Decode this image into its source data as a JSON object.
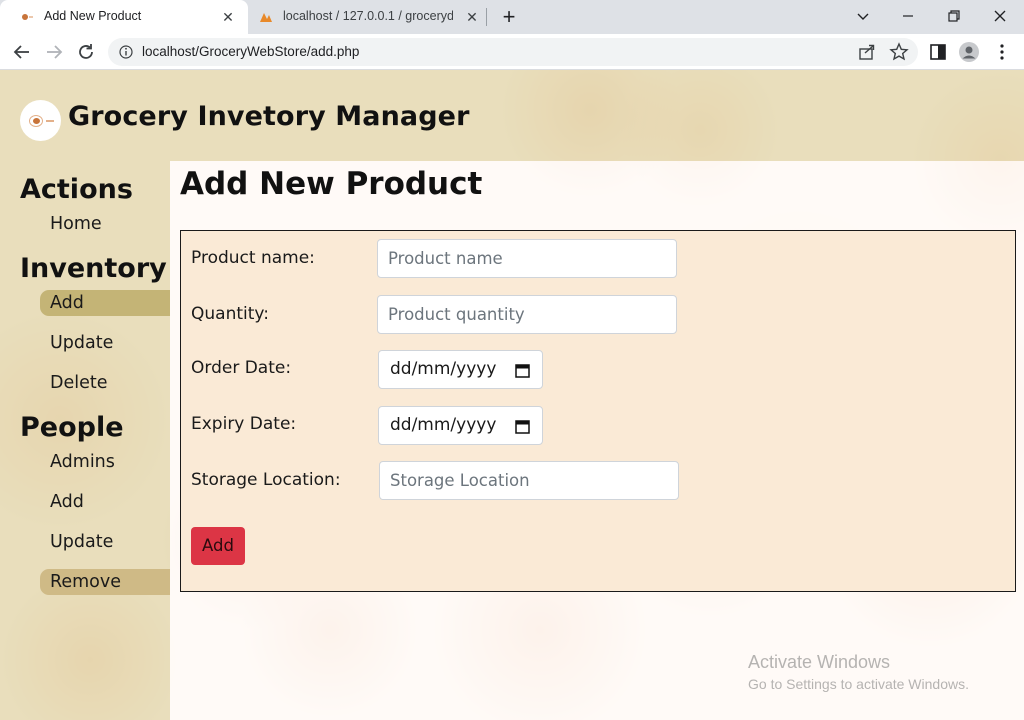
{
  "browser": {
    "tabs": [
      {
        "title": "Add New Product",
        "active": true
      },
      {
        "title": "localhost / 127.0.0.1 / grocerydb",
        "active": false
      }
    ],
    "address": "localhost/GroceryWebStore/add.php"
  },
  "app": {
    "title": "Grocery Invetory Manager"
  },
  "sidebar": {
    "sections": [
      {
        "heading": "Actions",
        "items": [
          {
            "label": "Home"
          }
        ]
      },
      {
        "heading": "Inventory",
        "items": [
          {
            "label": "Add",
            "selected": true
          },
          {
            "label": "Update"
          },
          {
            "label": "Delete"
          }
        ]
      },
      {
        "heading": "People",
        "items": [
          {
            "label": "Admins"
          },
          {
            "label": "Add"
          },
          {
            "label": "Update"
          },
          {
            "label": "Remove",
            "hovered": true
          }
        ]
      }
    ]
  },
  "main": {
    "title": "Add New Product",
    "form": {
      "fields": [
        {
          "label": "Product name:",
          "placeholder": "Product name"
        },
        {
          "label": "Quantity:",
          "placeholder": "Product quantity"
        },
        {
          "label": "Order Date:",
          "value": "dd/mm/yyyy"
        },
        {
          "label": "Expiry Date:",
          "value": "dd/mm/yyyy"
        },
        {
          "label": "Storage Location:",
          "placeholder": "Storage Location"
        }
      ],
      "submit_label": "Add"
    }
  },
  "watermark": {
    "line1": "Activate Windows",
    "line2": "Go to Settings to activate Windows."
  },
  "colors": {
    "accent_button": "#dc3545",
    "sidebar_selected": "#c4b476",
    "form_background": "#faead6"
  }
}
